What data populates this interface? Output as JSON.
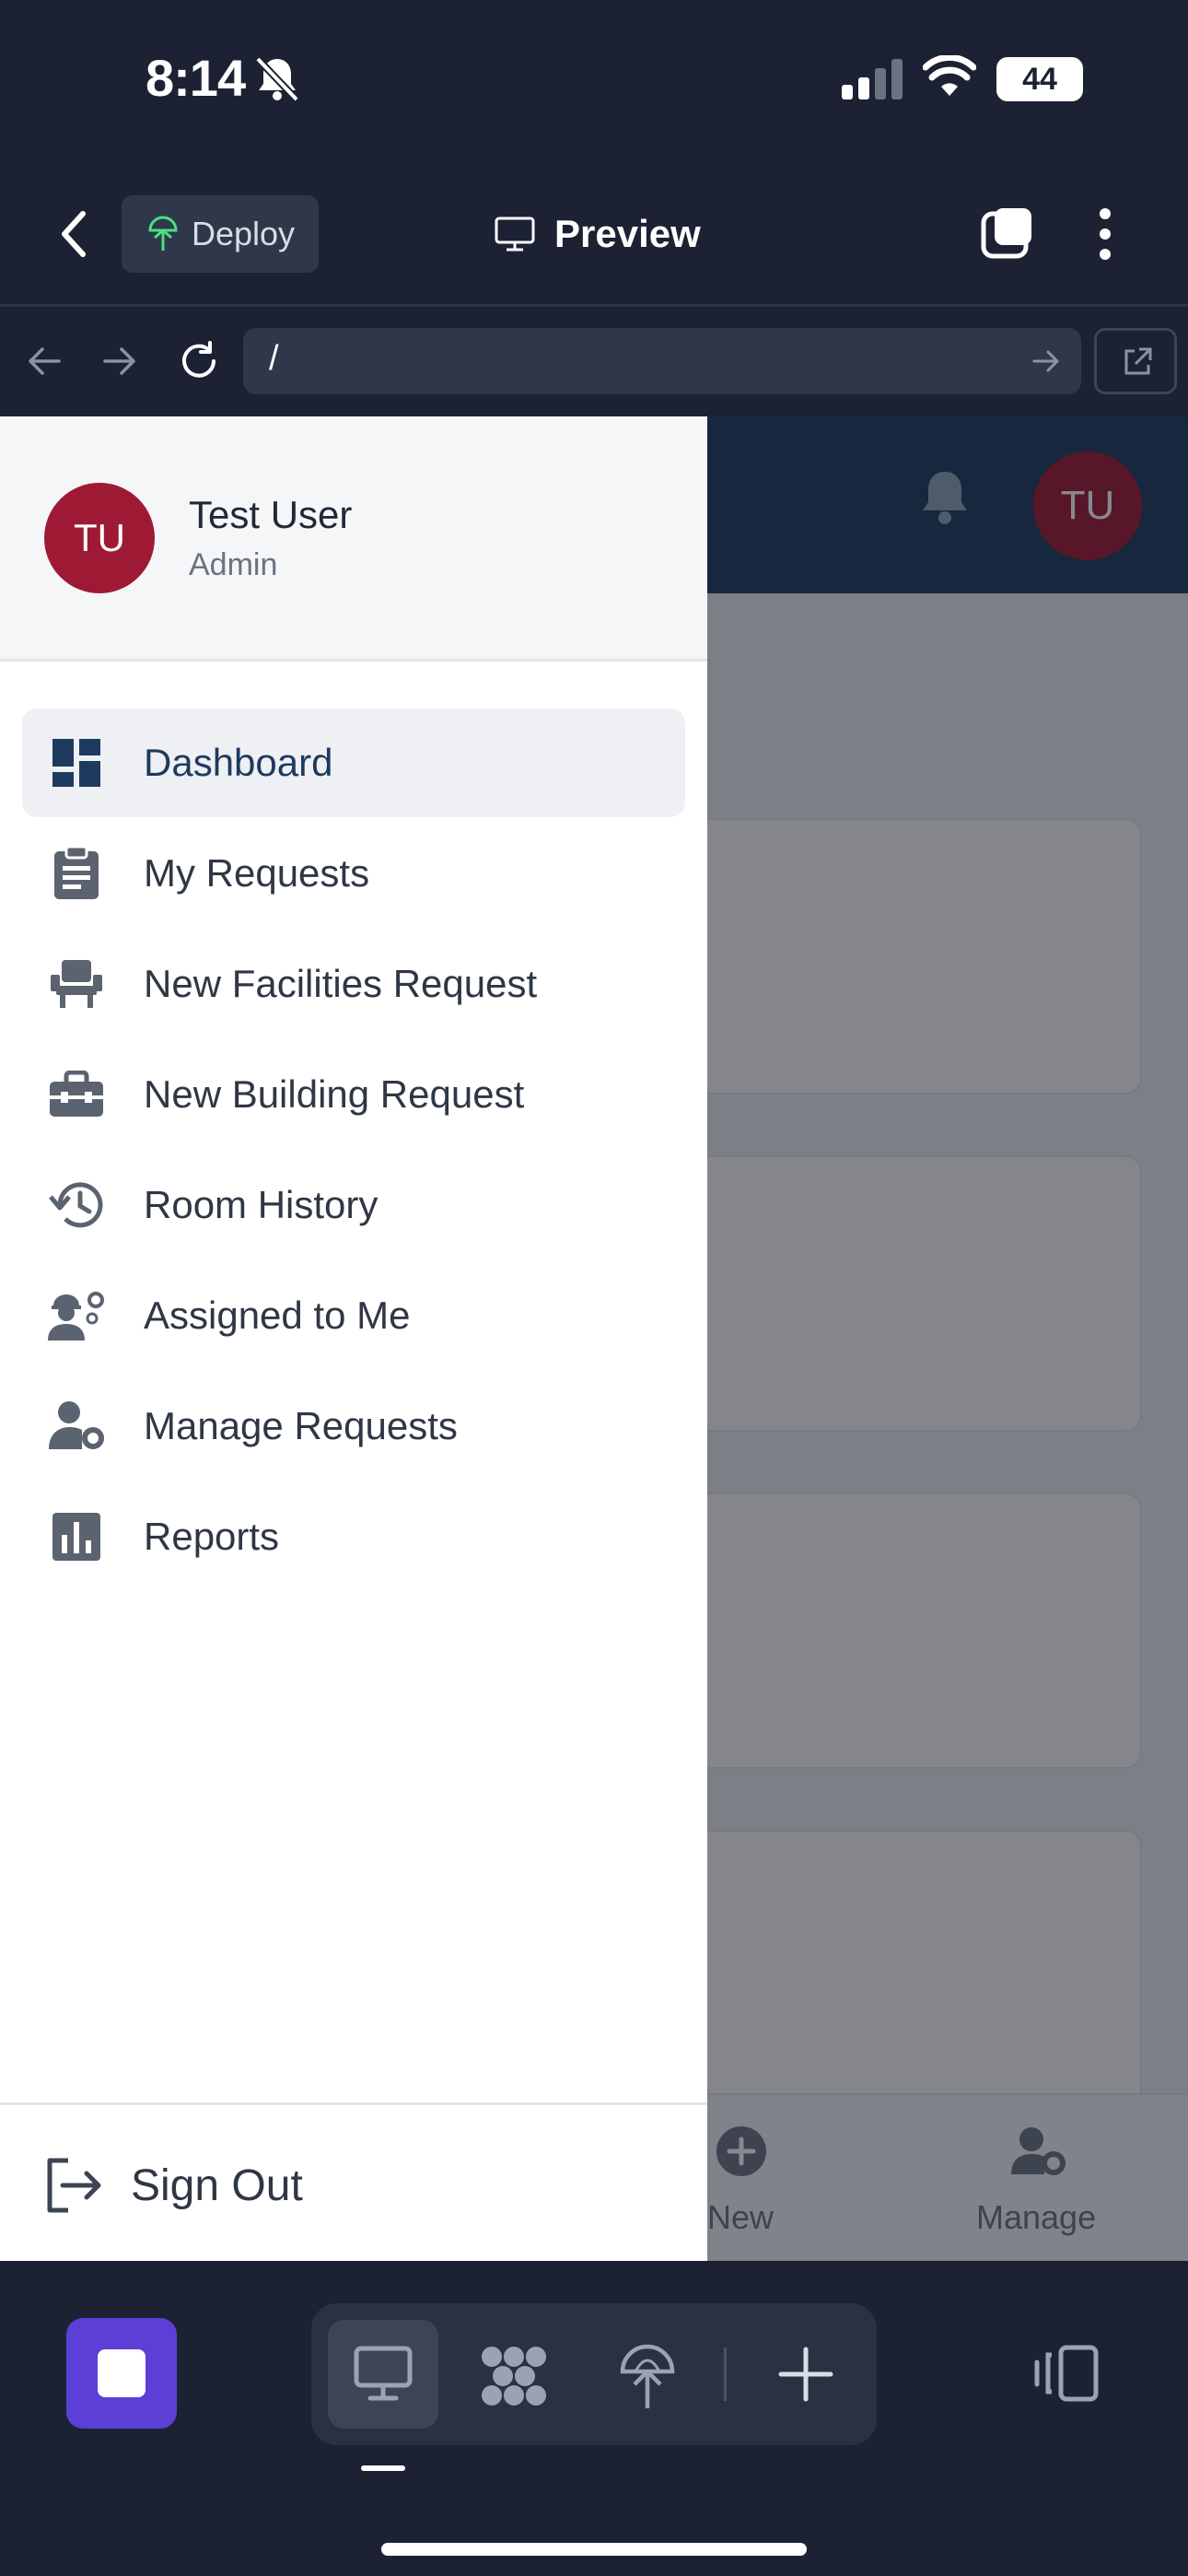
{
  "status_bar": {
    "time": "8:14",
    "battery": "44"
  },
  "app_bar": {
    "deploy_label": "Deploy",
    "preview_label": "Preview"
  },
  "url_bar": {
    "url": "/"
  },
  "web": {
    "avatar_initials": "TU",
    "bottom_nav": {
      "new_label": "New",
      "manage_label": "Manage"
    }
  },
  "drawer": {
    "user": {
      "initials": "TU",
      "name": "Test User",
      "role": "Admin"
    },
    "items": [
      {
        "label": "Dashboard",
        "icon": "dashboard-icon",
        "active": true
      },
      {
        "label": "My Requests",
        "icon": "clipboard-icon"
      },
      {
        "label": "New Facilities Request",
        "icon": "chair-icon"
      },
      {
        "label": "New Building Request",
        "icon": "toolbox-icon"
      },
      {
        "label": "Room History",
        "icon": "history-icon"
      },
      {
        "label": "Assigned to Me",
        "icon": "worker-gear-icon"
      },
      {
        "label": "Manage Requests",
        "icon": "user-gear-icon"
      },
      {
        "label": "Reports",
        "icon": "bar-chart-icon"
      }
    ],
    "sign_out": "Sign Out"
  },
  "colors": {
    "accent": "#5b3fd6",
    "avatar": "#9e1a34",
    "brand_navy": "#1e3a5f",
    "active_text": "#1e3a5f"
  }
}
